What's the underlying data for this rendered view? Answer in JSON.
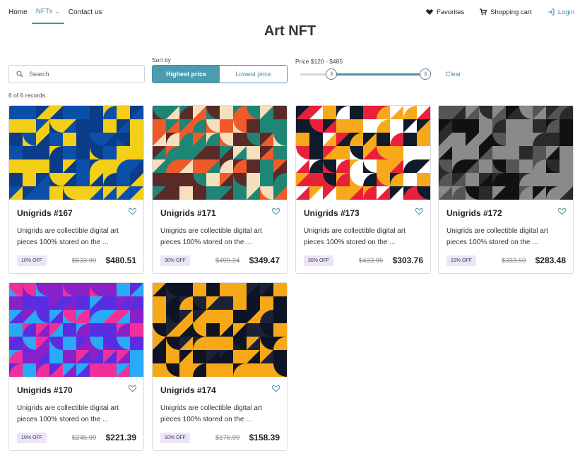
{
  "nav": {
    "home": "Home",
    "nfts": "NFTs",
    "contact": "Contact us",
    "favorites": "Favorites",
    "cart": "Shopping cart",
    "login": "Login"
  },
  "page_title": "Art NFT",
  "search": {
    "placeholder": "Search",
    "value": ""
  },
  "sort": {
    "label": "Sort by",
    "highest": "Highest price",
    "lowest": "Lowest price",
    "selected": "Highest price"
  },
  "price": {
    "label": "Price $120 - $485",
    "min": 120,
    "max": 485
  },
  "clear": "Clear",
  "records": "6 of 6 records",
  "accent": "#4a90a4",
  "cards": [
    {
      "name": "Unigrids #167",
      "desc": "Unigrids are collectible digital art pieces 100% stored on the ...",
      "badge": "10% OFF",
      "old": "$533.90",
      "price": "$480.51",
      "palette": [
        "#0b4fa8",
        "#f3cf17",
        "#0a3c88"
      ]
    },
    {
      "name": "Unigrids #171",
      "desc": "Unigrids are collectible digital art pieces 100% stored on the ...",
      "badge": "30% OFF",
      "old": "$499.24",
      "price": "$349.47",
      "palette": [
        "#1f8574",
        "#f05a2a",
        "#5a2a28",
        "#f5dfbd"
      ]
    },
    {
      "name": "Unigrids #173",
      "desc": "Unigrids are collectible digital art pieces 100% stored on the ...",
      "badge": "30% OFF",
      "old": "$433.95",
      "price": "$303.76",
      "palette": [
        "#0f1a2a",
        "#e8203a",
        "#f7a81b",
        "#ffffff"
      ]
    },
    {
      "name": "Unigrids #172",
      "desc": "Unigrids are collectible digital art pieces 100% stored on the ...",
      "badge": "15% OFF",
      "old": "$333.50",
      "price": "$283.48",
      "palette": [
        "#111111",
        "#555555",
        "#8a8a8a",
        "#2a2a2a"
      ]
    },
    {
      "name": "Unigrids #170",
      "desc": "Unigrids are collectible digital art pieces 100% stored on the ...",
      "badge": "10% OFF",
      "old": "$245.99",
      "price": "$221.39",
      "palette": [
        "#5a2ee0",
        "#f0309a",
        "#2aa9f5",
        "#8a20c8"
      ]
    },
    {
      "name": "Unigrids #174",
      "desc": "Unigrids are collectible digital art pieces 100% stored on the ...",
      "badge": "10% OFF",
      "old": "$175.99",
      "price": "$158.39",
      "palette": [
        "#f7a818",
        "#0f1424",
        "#f7a818",
        "#1b2238"
      ]
    }
  ]
}
